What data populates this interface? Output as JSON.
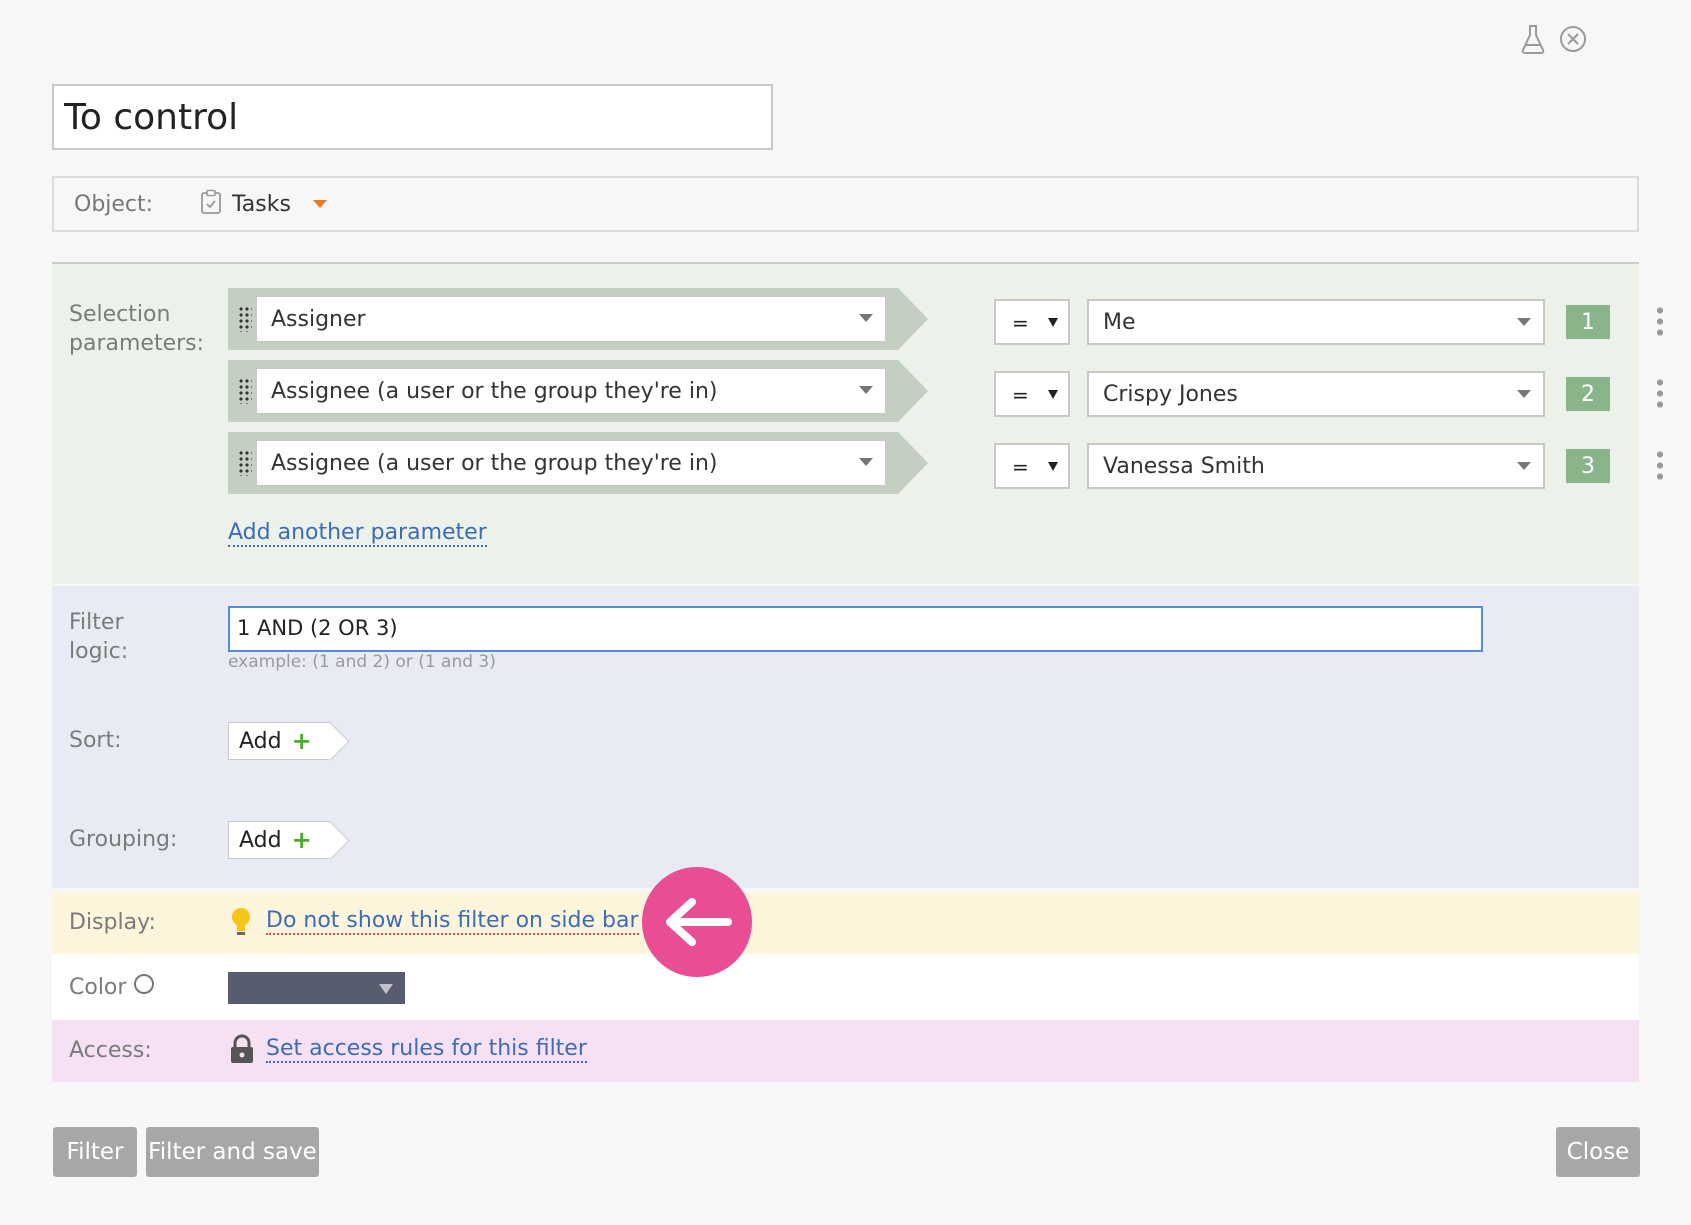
{
  "title": {
    "value": "To control"
  },
  "object": {
    "label": "Object:",
    "value": "Tasks"
  },
  "selection": {
    "label_line1": "Selection",
    "label_line2": "parameters:",
    "params": [
      {
        "field": "Assigner",
        "operator": "=",
        "value": "Me",
        "index": "1"
      },
      {
        "field": "Assignee (a user or the group they're in)",
        "operator": "=",
        "value": "Crispy Jones",
        "index": "2"
      },
      {
        "field": "Assignee (a user or the group they're in)",
        "operator": "=",
        "value": "Vanessa Smith",
        "index": "3"
      }
    ],
    "add_link": "Add another parameter"
  },
  "logic": {
    "label_line1": "Filter",
    "label_line2": "logic:",
    "value": "1 AND (2 OR 3)",
    "hint": "example: (1 and 2) or (1 and 3)"
  },
  "sort": {
    "label": "Sort:",
    "add_label": "Add"
  },
  "grouping": {
    "label": "Grouping:",
    "add_label": "Add"
  },
  "display": {
    "label": "Display:",
    "link": "Do not show this filter on side bar"
  },
  "color": {
    "label": "Color",
    "swatch": "#575c6e"
  },
  "access": {
    "label": "Access:",
    "link": "Set access rules for this filter"
  },
  "footer": {
    "filter": "Filter",
    "filter_and_save": "Filter and save",
    "close": "Close"
  },
  "icons": {
    "top_right": [
      "flask-icon",
      "close-circle-icon"
    ],
    "object": "clipboard-icon",
    "display": "lightbulb-icon",
    "access": "lock-icon",
    "overlay": "arrow-left-icon"
  },
  "colors": {
    "accent_link": "#3d6cb5",
    "badge": "#8ab48a",
    "overlay": "#e94d94",
    "plus": "#4bab2a"
  }
}
